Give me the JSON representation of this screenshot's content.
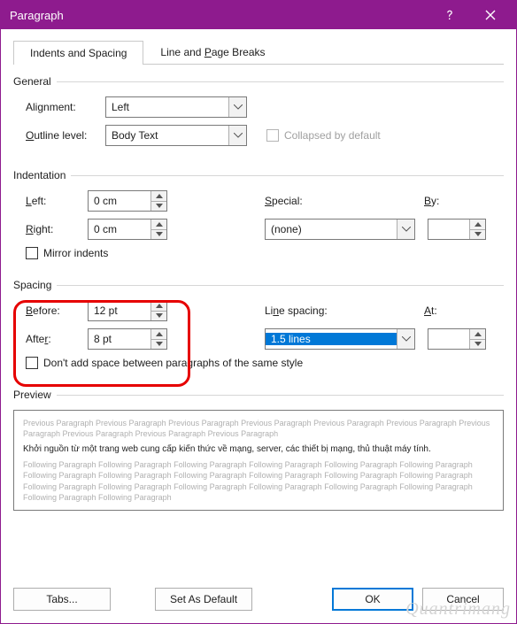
{
  "title": "Paragraph",
  "tabs": {
    "t1": "Indents and Spacing",
    "t2": "Line and Page Breaks",
    "t2_u": "P"
  },
  "general": {
    "legend": "General",
    "alignment_label": "Alignment:",
    "alignment_u": "G",
    "alignment_value": "Left",
    "outline_label": "utline level:",
    "outline_u": "O",
    "outline_value": "Body Text",
    "collapsed_label": "Collapsed by default"
  },
  "indentation": {
    "legend": "Indentation",
    "left_label": "eft:",
    "left_u": "L",
    "left_value": "0 cm",
    "right_label": "ight:",
    "right_u": "R",
    "right_value": "0 cm",
    "special_label": "pecial:",
    "special_u": "S",
    "special_value": "(none)",
    "by_label": "y:",
    "by_u": "B",
    "by_value": "",
    "mirror_label": "Mirror indents"
  },
  "spacing": {
    "legend": "Spacing",
    "before_label": "efore:",
    "before_u": "B",
    "before_value": "12 pt",
    "after_label": "Afte",
    "after_u": "r",
    "after_suffix": ":",
    "after_value": "8 pt",
    "line_label": "Li",
    "line_u": "n",
    "line_suffix": "e spacing:",
    "line_value": "1.5 lines",
    "at_label": "t:",
    "at_u": "A",
    "at_value": "",
    "dont_add_label": "Don't add space between paragraphs of the same style"
  },
  "preview": {
    "legend": "Preview",
    "prev_text": "Previous Paragraph Previous Paragraph Previous Paragraph Previous Paragraph Previous Paragraph Previous Paragraph Previous Paragraph Previous Paragraph Previous Paragraph Previous Paragraph",
    "sample_text": "Khởi nguồn từ một trang web cung cấp kiến thức về mạng, server, các thiết bị mạng, thủ thuật máy tính.",
    "foll_text": "Following Paragraph Following Paragraph Following Paragraph Following Paragraph Following Paragraph Following Paragraph Following Paragraph Following Paragraph Following Paragraph Following Paragraph Following Paragraph Following Paragraph Following Paragraph Following Paragraph Following Paragraph Following Paragraph Following Paragraph Following Paragraph Following Paragraph Following Paragraph"
  },
  "buttons": {
    "tabs": "Tabs...",
    "tabs_u": "T",
    "default": "Set As ",
    "default_u": "D",
    "default_suffix": "efault",
    "ok": "OK",
    "cancel": "Cancel"
  },
  "watermark": "Quantrimang"
}
